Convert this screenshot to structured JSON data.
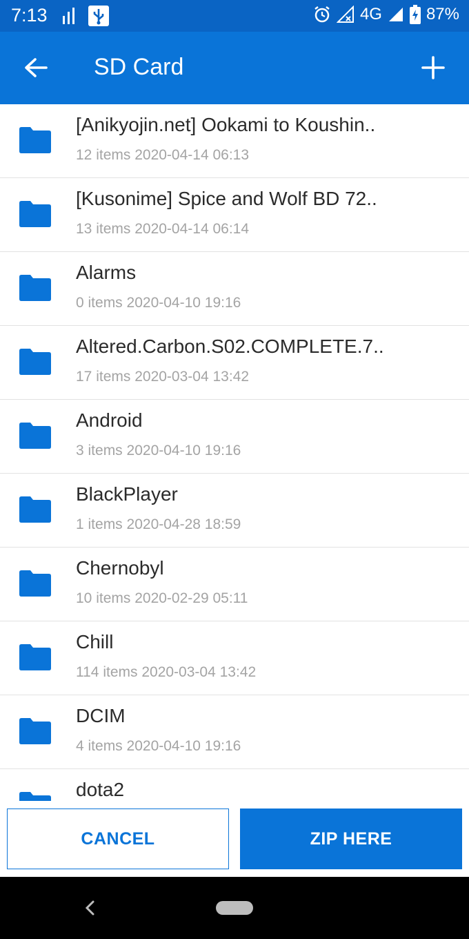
{
  "status_bar": {
    "time": "7:13",
    "network": "4G",
    "battery": "87%"
  },
  "app_bar": {
    "title": "SD Card",
    "back_icon": "arrow-left-icon",
    "add_icon": "plus-icon"
  },
  "folders": [
    {
      "name": "[Anikyojin.net] Ookami to Koushin..",
      "items": "12 items",
      "date": "2020-04-14 06:13"
    },
    {
      "name": "[Kusonime] Spice and Wolf BD 72..",
      "items": "13 items",
      "date": "2020-04-14 06:14"
    },
    {
      "name": "Alarms",
      "items": "0 items",
      "date": "2020-04-10 19:16"
    },
    {
      "name": "Altered.Carbon.S02.COMPLETE.7..",
      "items": "17 items",
      "date": "2020-03-04 13:42"
    },
    {
      "name": "Android",
      "items": "3 items",
      "date": "2020-04-10 19:16"
    },
    {
      "name": "BlackPlayer",
      "items": "1 items",
      "date": "2020-04-28 18:59"
    },
    {
      "name": "Chernobyl",
      "items": "10 items",
      "date": "2020-02-29 05:11"
    },
    {
      "name": "Chill",
      "items": "114 items",
      "date": "2020-03-04 13:42"
    },
    {
      "name": "DCIM",
      "items": "4 items",
      "date": "2020-04-10 19:16"
    },
    {
      "name": "dota2",
      "items": "",
      "date": ""
    }
  ],
  "buttons": {
    "cancel": "CANCEL",
    "zip_here": "ZIP HERE"
  },
  "colors": {
    "status_bar": "#0a64c4",
    "app_bar": "#0a74d8",
    "folder_icon": "#0a74d8",
    "meta_text": "#a4a4a4"
  }
}
